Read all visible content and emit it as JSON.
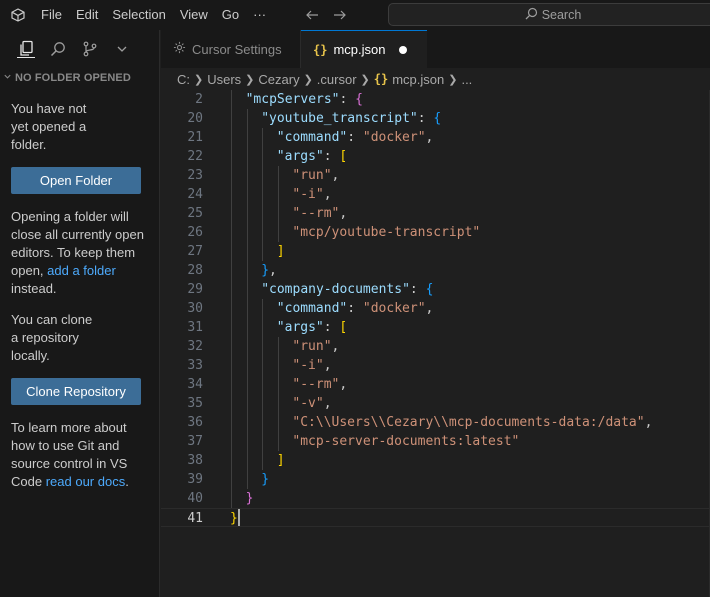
{
  "titlebar": {
    "menu": [
      "File",
      "Edit",
      "Selection",
      "View",
      "Go",
      "···"
    ],
    "search_placeholder": "Search"
  },
  "sidebar": {
    "header": "NO FOLDER OPENED",
    "msg1": "You have not yet opened a folder.",
    "open_folder_label": "Open Folder",
    "msg2_pre": "Opening a folder will close all currently open editors. To keep them open, ",
    "msg2_link": "add a folder",
    "msg2_post": " instead.",
    "msg3": "You can clone a repository locally.",
    "clone_label": "Clone Repository",
    "msg4_pre": "To learn more about how to use Git and source control in VS Code ",
    "msg4_link": "read our docs",
    "msg4_post": "."
  },
  "tabs": [
    {
      "label": "Cursor Settings",
      "active": false
    },
    {
      "label": "mcp.json",
      "active": true,
      "dirty": true
    }
  ],
  "breadcrumb": [
    "C:",
    "Users",
    "Cezary",
    ".cursor",
    "mcp.json",
    "..."
  ],
  "editor": {
    "current_line": "41",
    "lines": [
      {
        "n": "2",
        "indent": 1,
        "tokens": [
          [
            "k",
            "\"mcpServers\""
          ],
          [
            "p",
            ": "
          ],
          [
            "b1",
            "{"
          ]
        ]
      },
      {
        "n": "20",
        "indent": 2,
        "tokens": [
          [
            "k",
            "\"youtube_transcript\""
          ],
          [
            "p",
            ": "
          ],
          [
            "b2",
            "{"
          ]
        ]
      },
      {
        "n": "21",
        "indent": 3,
        "tokens": [
          [
            "k",
            "\"command\""
          ],
          [
            "p",
            ": "
          ],
          [
            "s",
            "\"docker\""
          ],
          [
            "p",
            ","
          ]
        ]
      },
      {
        "n": "22",
        "indent": 3,
        "tokens": [
          [
            "k",
            "\"args\""
          ],
          [
            "p",
            ": "
          ],
          [
            "b3",
            "["
          ]
        ]
      },
      {
        "n": "23",
        "indent": 4,
        "tokens": [
          [
            "s",
            "\"run\""
          ],
          [
            "p",
            ","
          ]
        ]
      },
      {
        "n": "24",
        "indent": 4,
        "tokens": [
          [
            "s",
            "\"-i\""
          ],
          [
            "p",
            ","
          ]
        ]
      },
      {
        "n": "25",
        "indent": 4,
        "tokens": [
          [
            "s",
            "\"--rm\""
          ],
          [
            "p",
            ","
          ]
        ]
      },
      {
        "n": "26",
        "indent": 4,
        "tokens": [
          [
            "s",
            "\"mcp/youtube-transcript\""
          ]
        ]
      },
      {
        "n": "27",
        "indent": 3,
        "tokens": [
          [
            "b3",
            "]"
          ]
        ]
      },
      {
        "n": "28",
        "indent": 2,
        "tokens": [
          [
            "b2",
            "}"
          ],
          [
            "p",
            ","
          ]
        ]
      },
      {
        "n": "29",
        "indent": 2,
        "tokens": [
          [
            "k",
            "\"company-documents\""
          ],
          [
            "p",
            ": "
          ],
          [
            "b2",
            "{"
          ]
        ]
      },
      {
        "n": "30",
        "indent": 3,
        "tokens": [
          [
            "k",
            "\"command\""
          ],
          [
            "p",
            ": "
          ],
          [
            "s",
            "\"docker\""
          ],
          [
            "p",
            ","
          ]
        ]
      },
      {
        "n": "31",
        "indent": 3,
        "tokens": [
          [
            "k",
            "\"args\""
          ],
          [
            "p",
            ": "
          ],
          [
            "b3",
            "["
          ]
        ]
      },
      {
        "n": "32",
        "indent": 4,
        "tokens": [
          [
            "s",
            "\"run\""
          ],
          [
            "p",
            ","
          ]
        ]
      },
      {
        "n": "33",
        "indent": 4,
        "tokens": [
          [
            "s",
            "\"-i\""
          ],
          [
            "p",
            ","
          ]
        ]
      },
      {
        "n": "34",
        "indent": 4,
        "tokens": [
          [
            "s",
            "\"--rm\""
          ],
          [
            "p",
            ","
          ]
        ]
      },
      {
        "n": "35",
        "indent": 4,
        "tokens": [
          [
            "s",
            "\"-v\""
          ],
          [
            "p",
            ","
          ]
        ]
      },
      {
        "n": "36",
        "indent": 4,
        "tokens": [
          [
            "s",
            "\"C:\\\\Users\\\\Cezary\\\\mcp-documents-data:/data\""
          ],
          [
            "p",
            ","
          ]
        ]
      },
      {
        "n": "37",
        "indent": 4,
        "tokens": [
          [
            "s",
            "\"mcp-server-documents:latest\""
          ]
        ]
      },
      {
        "n": "38",
        "indent": 3,
        "tokens": [
          [
            "b3",
            "]"
          ]
        ]
      },
      {
        "n": "39",
        "indent": 2,
        "tokens": [
          [
            "b2",
            "}"
          ]
        ]
      },
      {
        "n": "40",
        "indent": 1,
        "tokens": [
          [
            "b1",
            "}"
          ]
        ]
      },
      {
        "n": "41",
        "indent": 0,
        "tokens": [
          [
            "b3",
            "}"
          ]
        ]
      }
    ]
  },
  "colors": {
    "accent": "#0078d4",
    "button": "#3c6d97",
    "key": "#9cdcfe",
    "string": "#ce9178"
  }
}
